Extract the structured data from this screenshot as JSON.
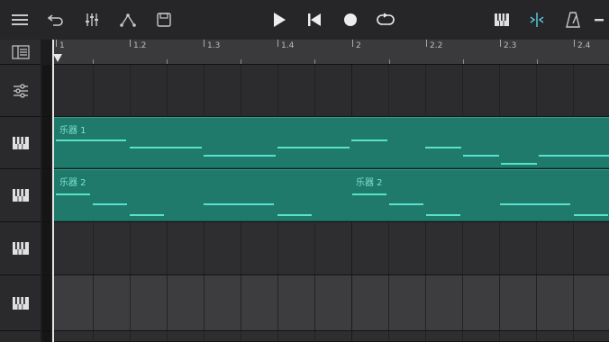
{
  "toolbar": {
    "left_buttons": [
      "menu-icon",
      "undo-icon",
      "mixer-icon",
      "automation-icon",
      "save-icon"
    ],
    "transport": [
      "play-icon",
      "rewind-to-start-icon",
      "record-icon",
      "loop-icon"
    ],
    "right_buttons": [
      "piano-keys-icon",
      "snap-icon",
      "metronome-icon"
    ],
    "accent": "#5ad1e6"
  },
  "ruler": {
    "labels": [
      "1",
      "1.2",
      "1.3",
      "1.4",
      "2",
      "2.2",
      "2.3",
      "2.4"
    ]
  },
  "tracks": [
    {
      "type": "master",
      "icon": "mixer-sliders-icon"
    },
    {
      "type": "instrument",
      "icon": "piano-keys-icon",
      "clips": [
        {
          "name": "乐器 1"
        }
      ]
    },
    {
      "type": "instrument",
      "icon": "piano-keys-icon",
      "clips": [
        {
          "name": "乐器 2"
        },
        {
          "name": "乐器 2"
        }
      ]
    },
    {
      "type": "instrument",
      "icon": "piano-keys-icon",
      "clips": []
    },
    {
      "type": "instrument",
      "icon": "piano-keys-icon",
      "clips": []
    }
  ],
  "colors": {
    "clip": "#1f7a6c",
    "note": "#58e3c6",
    "clip_label": "#7fe3cf"
  }
}
